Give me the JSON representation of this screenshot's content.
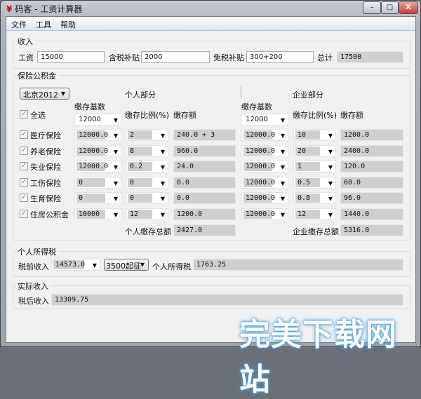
{
  "window": {
    "title": "码客 - 工资计算器",
    "logo": "¥",
    "min": "–",
    "max": "□",
    "close": "X"
  },
  "menu": [
    "文件",
    "工具",
    "帮助"
  ],
  "income": {
    "title": "收入",
    "salary_label": "工资",
    "salary": "15000",
    "taxable_label": "含税补贴",
    "taxable": "2000",
    "exempt_label": "免税补贴",
    "exempt": "300+200",
    "total_label": "总计",
    "total": "17500"
  },
  "insurance": {
    "title": "保险公积金",
    "region": "北京2012",
    "personal_title": "个人部分",
    "company_title": "企业部分",
    "base_header": "缴存基数",
    "ratio_header": "缴存比例(%)",
    "amount_header": "缴存额",
    "select_all": "全选",
    "personal_base": "12000",
    "company_base": "12000",
    "rows": [
      {
        "name": "医疗保险",
        "p_base": "12000.0",
        "p_ratio": "2",
        "p_amount": "240.0 + 3",
        "c_base": "12000.0",
        "c_ratio": "10",
        "c_amount": "1200.0"
      },
      {
        "name": "养老保险",
        "p_base": "12000.0",
        "p_ratio": "8",
        "p_amount": "960.0",
        "c_base": "12000.0",
        "c_ratio": "20",
        "c_amount": "2400.0"
      },
      {
        "name": "失业保险",
        "p_base": "12000.0",
        "p_ratio": "0.2",
        "p_amount": "24.0",
        "c_base": "12000.0",
        "c_ratio": "1",
        "c_amount": "120.0"
      },
      {
        "name": "工伤保险",
        "p_base": "0",
        "p_ratio": "0",
        "p_amount": "0.0",
        "c_base": "12000.0",
        "c_ratio": "0.5",
        "c_amount": "60.0"
      },
      {
        "name": "生育保险",
        "p_base": "0",
        "p_ratio": "0",
        "p_amount": "0.0",
        "c_base": "12000.0",
        "c_ratio": "0.8",
        "c_amount": "96.0"
      },
      {
        "name": "住房公积金",
        "p_base": "10000",
        "p_ratio": "12",
        "p_amount": "1200.0",
        "c_base": "12000.0",
        "c_ratio": "12",
        "c_amount": "1440.0"
      }
    ],
    "personal_total_label": "个人缴存总额",
    "personal_total": "2427.0",
    "company_total_label": "企业缴存总额",
    "company_total": "5316.0"
  },
  "tax": {
    "title": "个人所得税",
    "pretax_label": "税前收入",
    "pretax": "14573.0",
    "threshold": "3500起征",
    "tax_label": "个人所得税",
    "tax": "1763.25"
  },
  "net": {
    "title": "实际收入",
    "label": "税后收入",
    "value": "13309.75"
  },
  "watermark": "完美下载网站"
}
